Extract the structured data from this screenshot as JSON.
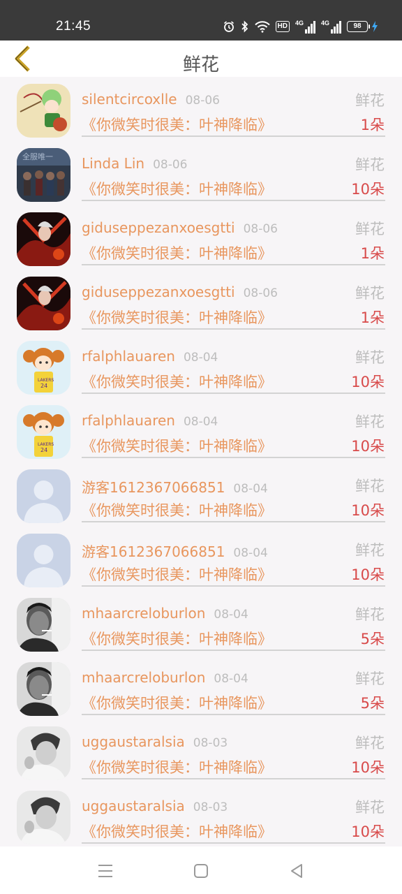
{
  "status_bar": {
    "time": "21:45",
    "hd_label": "HD",
    "net1_label": "4G",
    "net2_label": "4G",
    "battery_level": "98"
  },
  "header": {
    "title": "鲜花"
  },
  "records": [
    {
      "username": "silentcircoxlle",
      "date": "08-06",
      "gift_type": "鲜花",
      "novel": "《你微笑时很美：叶神降临》",
      "count": "1朵",
      "avatar": "anime-archer-avatar"
    },
    {
      "username": "Linda Lin",
      "date": "08-06",
      "gift_type": "鲜花",
      "novel": "《你微笑时很美：叶神降临》",
      "count": "10朵",
      "avatar": "game-group-avatar"
    },
    {
      "username": "giduseppezanxoesgtti",
      "date": "08-06",
      "gift_type": "鲜花",
      "novel": "《你微笑时很美：叶神降临》",
      "count": "1朵",
      "avatar": "red-warrior-avatar"
    },
    {
      "username": "giduseppezanxoesgtti",
      "date": "08-06",
      "gift_type": "鲜花",
      "novel": "《你微笑时很美：叶神降临》",
      "count": "1朵",
      "avatar": "red-warrior-avatar"
    },
    {
      "username": "rfalphlauaren",
      "date": "08-04",
      "gift_type": "鲜花",
      "novel": "《你微笑时很美：叶神降临》",
      "count": "10朵",
      "avatar": "cartoon-girl-avatar"
    },
    {
      "username": "rfalphlauaren",
      "date": "08-04",
      "gift_type": "鲜花",
      "novel": "《你微笑时很美：叶神降临》",
      "count": "10朵",
      "avatar": "cartoon-girl-avatar"
    },
    {
      "username": "游客1612367066851",
      "date": "08-04",
      "gift_type": "鲜花",
      "novel": "《你微笑时很美：叶神降临》",
      "count": "10朵",
      "avatar": "default-user-avatar"
    },
    {
      "username": "游客1612367066851",
      "date": "08-04",
      "gift_type": "鲜花",
      "novel": "《你微笑时很美：叶神降临》",
      "count": "10朵",
      "avatar": "default-user-avatar"
    },
    {
      "username": "mhaarcreloburlon",
      "date": "08-04",
      "gift_type": "鲜花",
      "novel": "《你微笑时很美：叶神降临》",
      "count": "5朵",
      "avatar": "bw-man-photo-avatar"
    },
    {
      "username": "mhaarcreloburlon",
      "date": "08-04",
      "gift_type": "鲜花",
      "novel": "《你微笑时很美：叶神降临》",
      "count": "5朵",
      "avatar": "bw-man-photo-avatar"
    },
    {
      "username": "uggaustaralsia",
      "date": "08-03",
      "gift_type": "鲜花",
      "novel": "《你微笑时很美：叶神降临》",
      "count": "10朵",
      "avatar": "bw-boy-photo-avatar"
    },
    {
      "username": "uggaustaralsia",
      "date": "08-03",
      "gift_type": "鲜花",
      "novel": "《你微笑时很美：叶神降临》",
      "count": "10朵",
      "avatar": "bw-boy-photo-avatar"
    }
  ],
  "colors": {
    "accent": "#e8965e",
    "count_red": "#d84a4a",
    "back_arrow": "#c9a227",
    "muted": "#bdbdbd"
  },
  "nav_bar": {
    "icons": [
      "menu-icon",
      "home-square-icon",
      "back-triangle-icon"
    ]
  }
}
